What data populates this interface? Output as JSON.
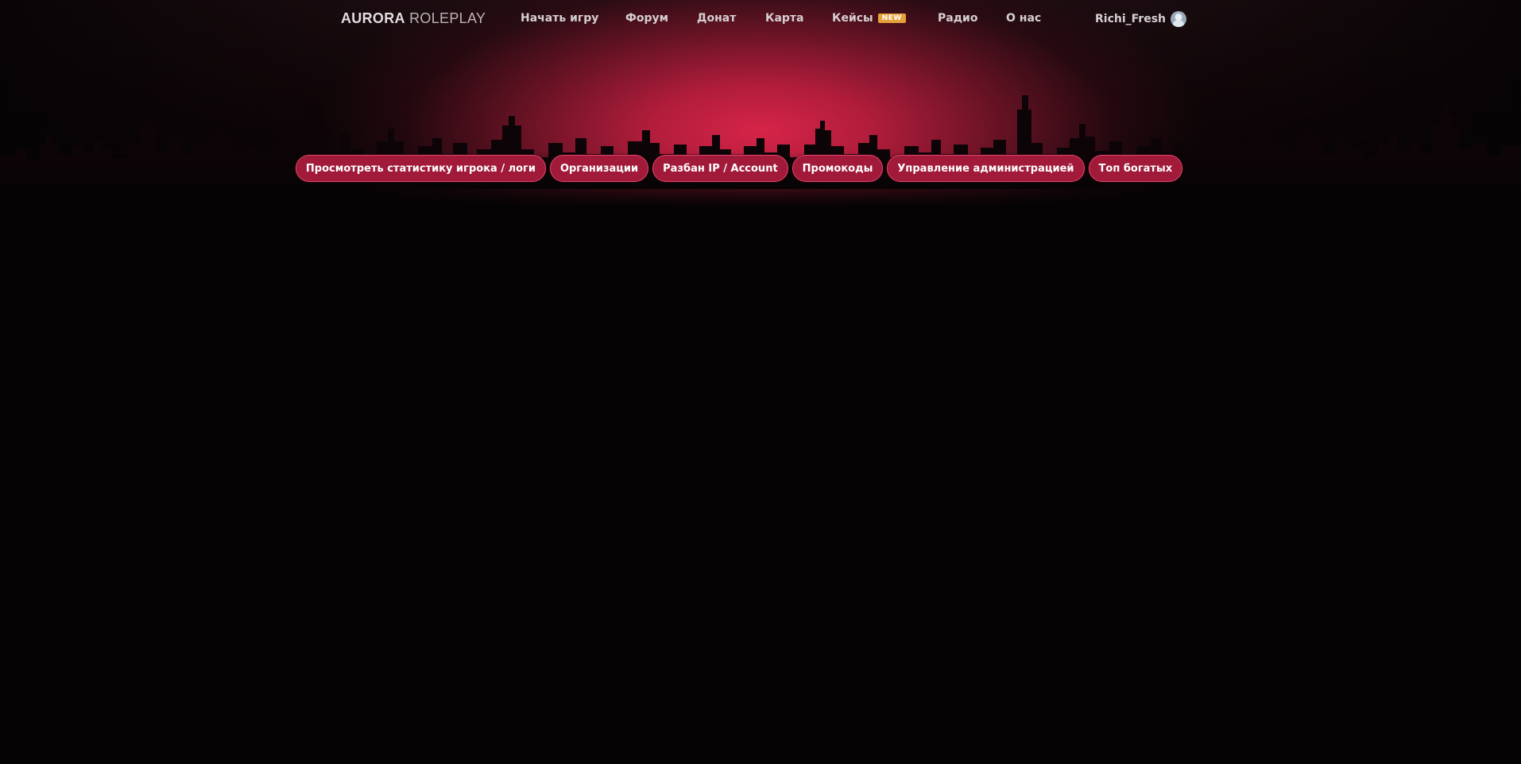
{
  "header": {
    "logo_bold": "AURORA",
    "logo_thin": "ROLEPLAY",
    "nav": [
      {
        "label": "Начать игру"
      },
      {
        "label": "Форум"
      },
      {
        "label": "Донат"
      },
      {
        "label": "Карта"
      },
      {
        "label": "Кейсы",
        "badge": "NEW"
      },
      {
        "label": "Радио"
      },
      {
        "label": "О нас"
      }
    ],
    "user": {
      "name": "Richi_Fresh",
      "avatar_icon": "user-avatar-icon"
    }
  },
  "subnav": [
    {
      "label": "Просмотреть статистику игрока / логи"
    },
    {
      "label": "Организации"
    },
    {
      "label": "Разбан IP / Account"
    },
    {
      "label": "Промокоды"
    },
    {
      "label": "Управление администрацией"
    },
    {
      "label": "Топ богатых"
    }
  ],
  "colors": {
    "background": "#050304",
    "accent": "#a11a39",
    "accent_border": "#d9486a",
    "glow": "#d62448",
    "badge": "#e6a23a",
    "nav_text": "#d6cfd1"
  }
}
